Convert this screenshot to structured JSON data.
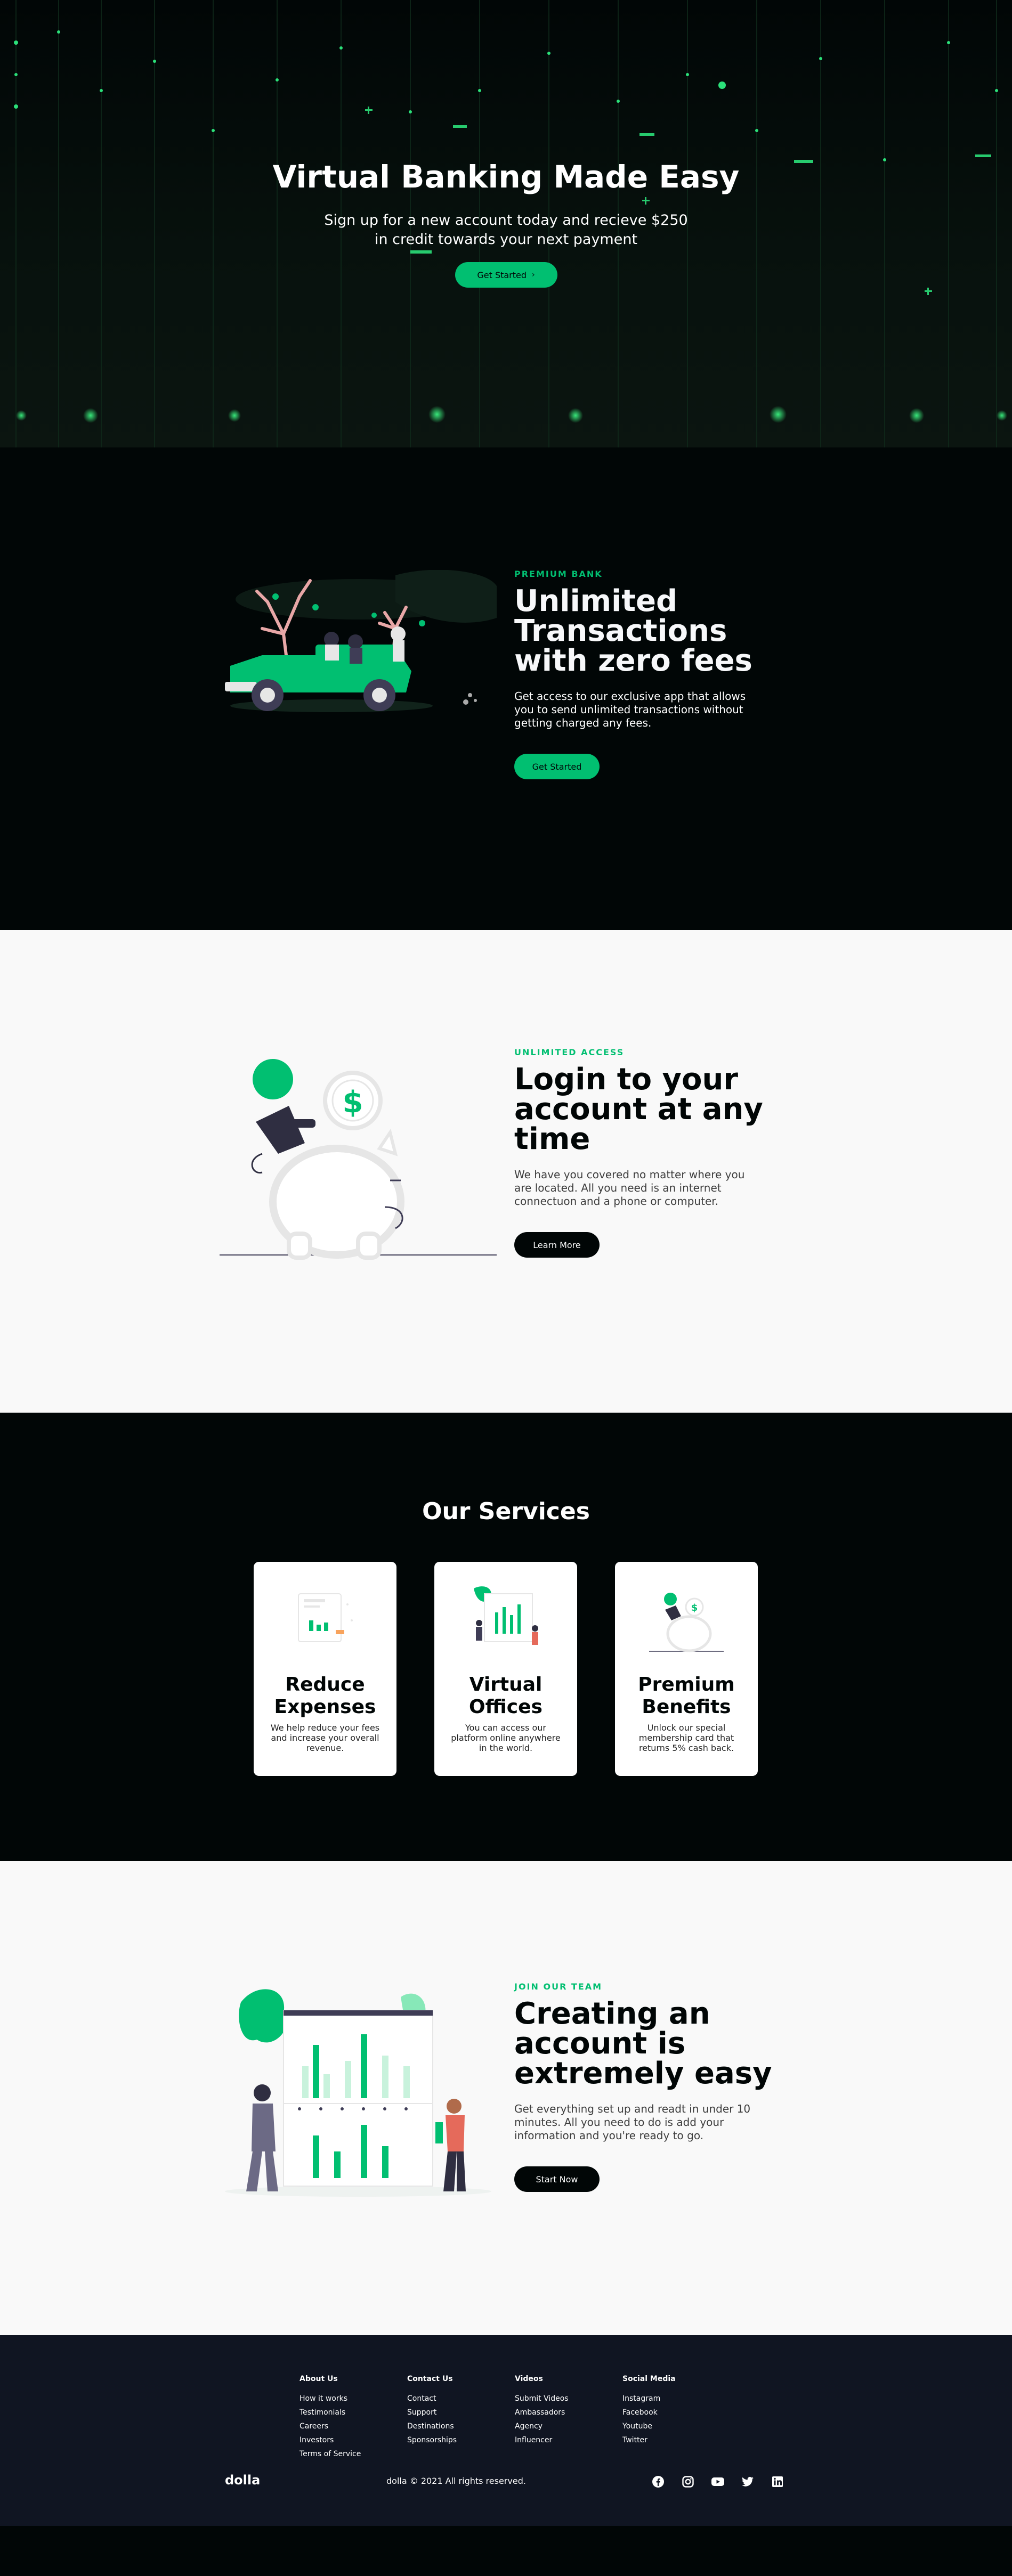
{
  "hero": {
    "title": "Virtual Banking Made Easy",
    "subtitle_line1": "Sign up for a new account today and recieve $250",
    "subtitle_line2": "in credit towards your next payment",
    "button_label": "Get Started",
    "button_icon": "chevron-right-icon"
  },
  "section1": {
    "topline": "Premium Bank",
    "heading": "Unlimited Transactions with zero fees",
    "description": "Get access to our exclusive app that allows you to send unlimited transactions without getting charged any fees.",
    "button_label": "Get Started"
  },
  "section2": {
    "topline": "Unlimited Access",
    "heading": "Login to your account at any time",
    "description": "We have you covered no matter where you are located. All you need is an internet connectuon and a phone or computer.",
    "button_label": "Learn More"
  },
  "services": {
    "title": "Our Services",
    "cards": [
      {
        "title_line1": "Reduce",
        "title_line2": "Expenses",
        "description": "We help reduce your fees and increase your overall revenue."
      },
      {
        "title_line1": "Virtual",
        "title_line2": "Offices",
        "description": "You can access our platform online anywhere in the world."
      },
      {
        "title_line1": "Premium",
        "title_line2": "Benefits",
        "description": "Unlock our special membership card that returns 5% cash back."
      }
    ]
  },
  "section3": {
    "topline": "Join our Team",
    "heading": "Creating an account is extremely easy",
    "description": "Get everything set up and readt in under 10 minutes. All you need to do is add your information and you're ready to go.",
    "button_label": "Start Now"
  },
  "footer": {
    "columns": [
      {
        "title": "About Us",
        "links": [
          "How it works",
          "Testimonials",
          "Careers",
          "Investors",
          "Terms of Service"
        ]
      },
      {
        "title": "Contact Us",
        "links": [
          "Contact",
          "Support",
          "Destinations",
          "Sponsorships"
        ]
      },
      {
        "title": "Videos",
        "links": [
          "Submit Videos",
          "Ambassadors",
          "Agency",
          "Influencer"
        ]
      },
      {
        "title": "Social Media",
        "links": [
          "Instagram",
          "Facebook",
          "Youtube",
          "Twitter"
        ]
      }
    ],
    "logo": "dolla",
    "rights": "dolla © 2021 All rights reserved.",
    "social_icons": [
      "facebook-icon",
      "instagram-icon",
      "youtube-icon",
      "twitter-icon",
      "linkedin-icon"
    ]
  },
  "colors": {
    "accent": "#01bf71",
    "dark_bg": "#010606",
    "light_bg": "#f9f9f9",
    "footer_bg": "#101522"
  }
}
